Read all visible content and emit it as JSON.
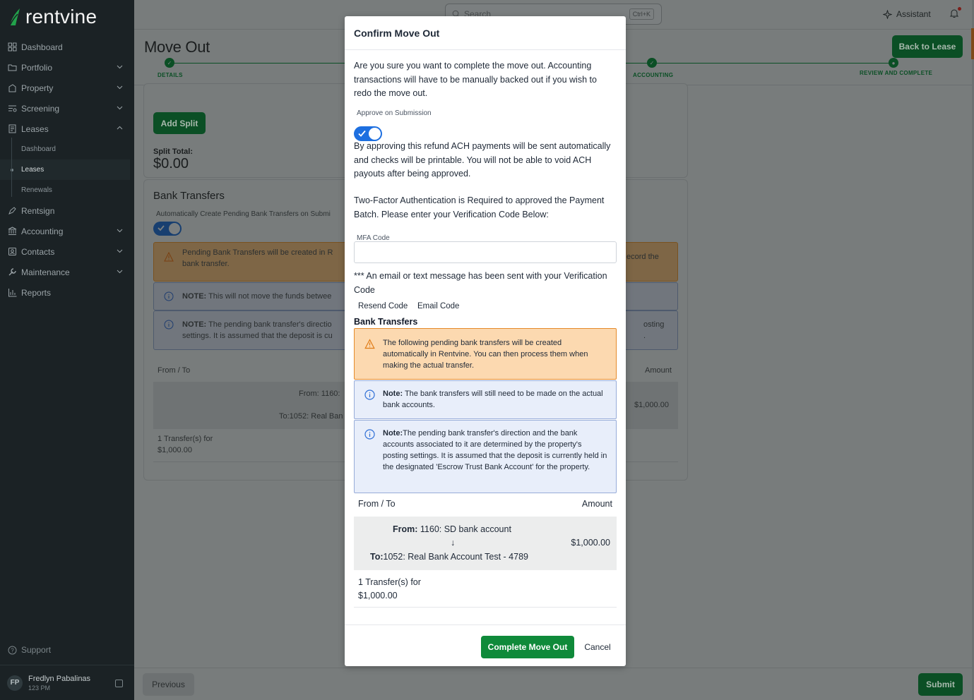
{
  "app": {
    "name": "rentvine"
  },
  "sidebar": {
    "items": [
      {
        "label": "Dashboard",
        "icon": "dashboard-icon"
      },
      {
        "label": "Portfolio",
        "icon": "folder-icon"
      },
      {
        "label": "Property",
        "icon": "building-icon"
      },
      {
        "label": "Screening",
        "icon": "screening-icon"
      },
      {
        "label": "Leases",
        "icon": "leases-icon"
      },
      {
        "label": "Rentsign",
        "icon": "pen-icon"
      },
      {
        "label": "Accounting",
        "icon": "bank-icon"
      },
      {
        "label": "Contacts",
        "icon": "contacts-icon"
      },
      {
        "label": "Maintenance",
        "icon": "wrench-icon"
      },
      {
        "label": "Reports",
        "icon": "chart-icon"
      }
    ],
    "lease_sub": [
      "Dashboard",
      "Leases",
      "Renewals"
    ],
    "support": "Support",
    "user": {
      "initials": "FP",
      "name": "Fredlyn Pabalinas",
      "time": "123 PM"
    }
  },
  "topbar": {
    "search_placeholder": "Search",
    "shortcut": "Ctrl+K",
    "assistant": "Assistant"
  },
  "page": {
    "title": "Move Out",
    "back_button": "Back to Lease",
    "steps": [
      "DETAILS",
      "ACCOUNTING",
      "REVIEW AND COMPLETE"
    ],
    "add_split": "Add Split",
    "split_total_label": "Split Total:",
    "split_total_value": "$0.00",
    "bank_transfers_title": "Bank Transfers",
    "auto_create_label": "Automatically Create Pending Bank Transfers on Submi",
    "alert_warn_left": "Pending Bank Transfers will be created in R",
    "alert_warn_left2": "bank transfer.",
    "alert_warn_right": "ecord the",
    "note1_bold": "NOTE:",
    "note1_text": " This will not move the funds betwee",
    "note2_bold": "NOTE:",
    "note2_text": " The pending bank transfer's directio",
    "note2_line2": "settings. It is assumed that the deposit is cu",
    "note2_right1": "osting",
    "note2_right2": ".",
    "col_from_to": "From / To",
    "col_amount": "Amount",
    "row_from": "From: 1160: ",
    "row_to": "To:1052: Real Ban",
    "row_amount": "$1,000.00",
    "summary_line1": "1 Transfer(s) for",
    "summary_line2": "$1,000.00",
    "previous": "Previous",
    "submit": "Submit"
  },
  "modal": {
    "title": "Confirm Move Out",
    "intro": "Are you sure you want to complete the move out. Accounting transactions will have to be manually backed out if you wish to redo the move out.",
    "approve_label": "Approve on Submission",
    "approve_text": "By approving this refund ACH payments will be sent automatically and checks will be printable. You will not be able to void ACH payouts after being approved.",
    "twofa_text": "Two-Factor Authentication is Required to approved the Payment Batch. Please enter your Verification Code Below:",
    "mfa_label": "MFA Code",
    "mfa_value": "",
    "sent_text": "*** An email or text message has been sent with your Verification Code",
    "resend": "Resend Code",
    "email_code": "Email Code",
    "bank_title": "Bank Transfers",
    "warn_text": "The following pending bank transfers will be created automatically in Rentvine. You can then process them when making the actual transfer.",
    "note1_bold": "Note:",
    "note1_text": " The bank transfers will still need to be made on the actual bank accounts.",
    "note2_bold": "Note:",
    "note2_text": "The pending bank transfer's direction and the bank accounts associated to it are determined by the property's posting settings. It is assumed that the deposit is currently held in the designated 'Escrow Trust Bank Account' for the property.",
    "col_from_to": "From / To",
    "col_amount": "Amount",
    "from_label": "From:",
    "from_value": " 1160: SD bank account",
    "arrow": "↓",
    "to_label": "To:",
    "to_value": "1052: Real Bank Account Test - 4789",
    "amount": "$1,000.00",
    "summary_line1": "1 Transfer(s) for",
    "summary_line2": "$1,000.00",
    "complete_button": "Complete Move Out",
    "cancel_button": "Cancel"
  }
}
